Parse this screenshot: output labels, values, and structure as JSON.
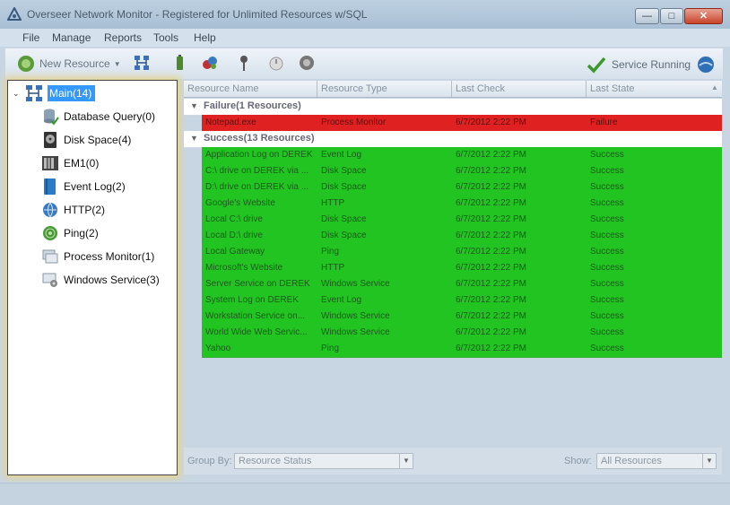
{
  "window": {
    "title": "Overseer Network Monitor - Registered for Unlimited Resources w/SQL"
  },
  "menu": [
    "File",
    "Manage",
    "Reports",
    "Tools",
    "Help"
  ],
  "toolbar": {
    "new_resource_label": "New Resource",
    "service_status": "Service Running"
  },
  "tree": {
    "root": "Main(14)",
    "items": [
      {
        "label": "Database Query(0)",
        "icon": "database-icon"
      },
      {
        "label": "Disk Space(4)",
        "icon": "disk-icon"
      },
      {
        "label": "EM1(0)",
        "icon": "em1-icon"
      },
      {
        "label": "Event Log(2)",
        "icon": "event-log-icon"
      },
      {
        "label": "HTTP(2)",
        "icon": "http-globe-icon"
      },
      {
        "label": "Ping(2)",
        "icon": "ping-radar-icon"
      },
      {
        "label": "Process Monitor(1)",
        "icon": "process-monitor-icon"
      },
      {
        "label": "Windows Service(3)",
        "icon": "windows-service-icon"
      }
    ]
  },
  "grid": {
    "columns": [
      "Resource Name",
      "Resource Type",
      "Last Check",
      "Last State"
    ],
    "groups": [
      {
        "label": "Failure(1 Resources)",
        "status": "failure",
        "rows": [
          [
            "Notepad.exe",
            "Process Monitor",
            "6/7/2012 2:22 PM",
            "Failure"
          ]
        ]
      },
      {
        "label": "Success(13 Resources)",
        "status": "success",
        "rows": [
          [
            "Application Log on DEREK",
            "Event Log",
            "6/7/2012 2:22 PM",
            "Success"
          ],
          [
            "C:\\ drive on DEREK via ...",
            "Disk Space",
            "6/7/2012 2:22 PM",
            "Success"
          ],
          [
            "D:\\ drive on DEREK via ...",
            "Disk Space",
            "6/7/2012 2:22 PM",
            "Success"
          ],
          [
            "Google's Website",
            "HTTP",
            "6/7/2012 2:22 PM",
            "Success"
          ],
          [
            "Local C:\\ drive",
            "Disk Space",
            "6/7/2012 2:22 PM",
            "Success"
          ],
          [
            "Local D:\\ drive",
            "Disk Space",
            "6/7/2012 2:22 PM",
            "Success"
          ],
          [
            "Local Gateway",
            "Ping",
            "6/7/2012 2:22 PM",
            "Success"
          ],
          [
            "Microsoft's Website",
            "HTTP",
            "6/7/2012 2:22 PM",
            "Success"
          ],
          [
            "Server Service on DEREK",
            "Windows Service",
            "6/7/2012 2:22 PM",
            "Success"
          ],
          [
            "System Log on DEREK",
            "Event Log",
            "6/7/2012 2:22 PM",
            "Success"
          ],
          [
            "Workstation Service on...",
            "Windows Service",
            "6/7/2012 2:22 PM",
            "Success"
          ],
          [
            "World Wide Web Servic...",
            "Windows Service",
            "6/7/2012 2:22 PM",
            "Success"
          ],
          [
            "Yahoo",
            "Ping",
            "6/7/2012 2:22 PM",
            "Success"
          ]
        ]
      }
    ]
  },
  "bottom": {
    "group_by_label": "Group By:",
    "group_by_value": "Resource Status",
    "show_label": "Show:",
    "show_value": "All Resources"
  },
  "colors": {
    "success": "#22c422",
    "failure": "#e02121",
    "selection": "#3399ff"
  }
}
